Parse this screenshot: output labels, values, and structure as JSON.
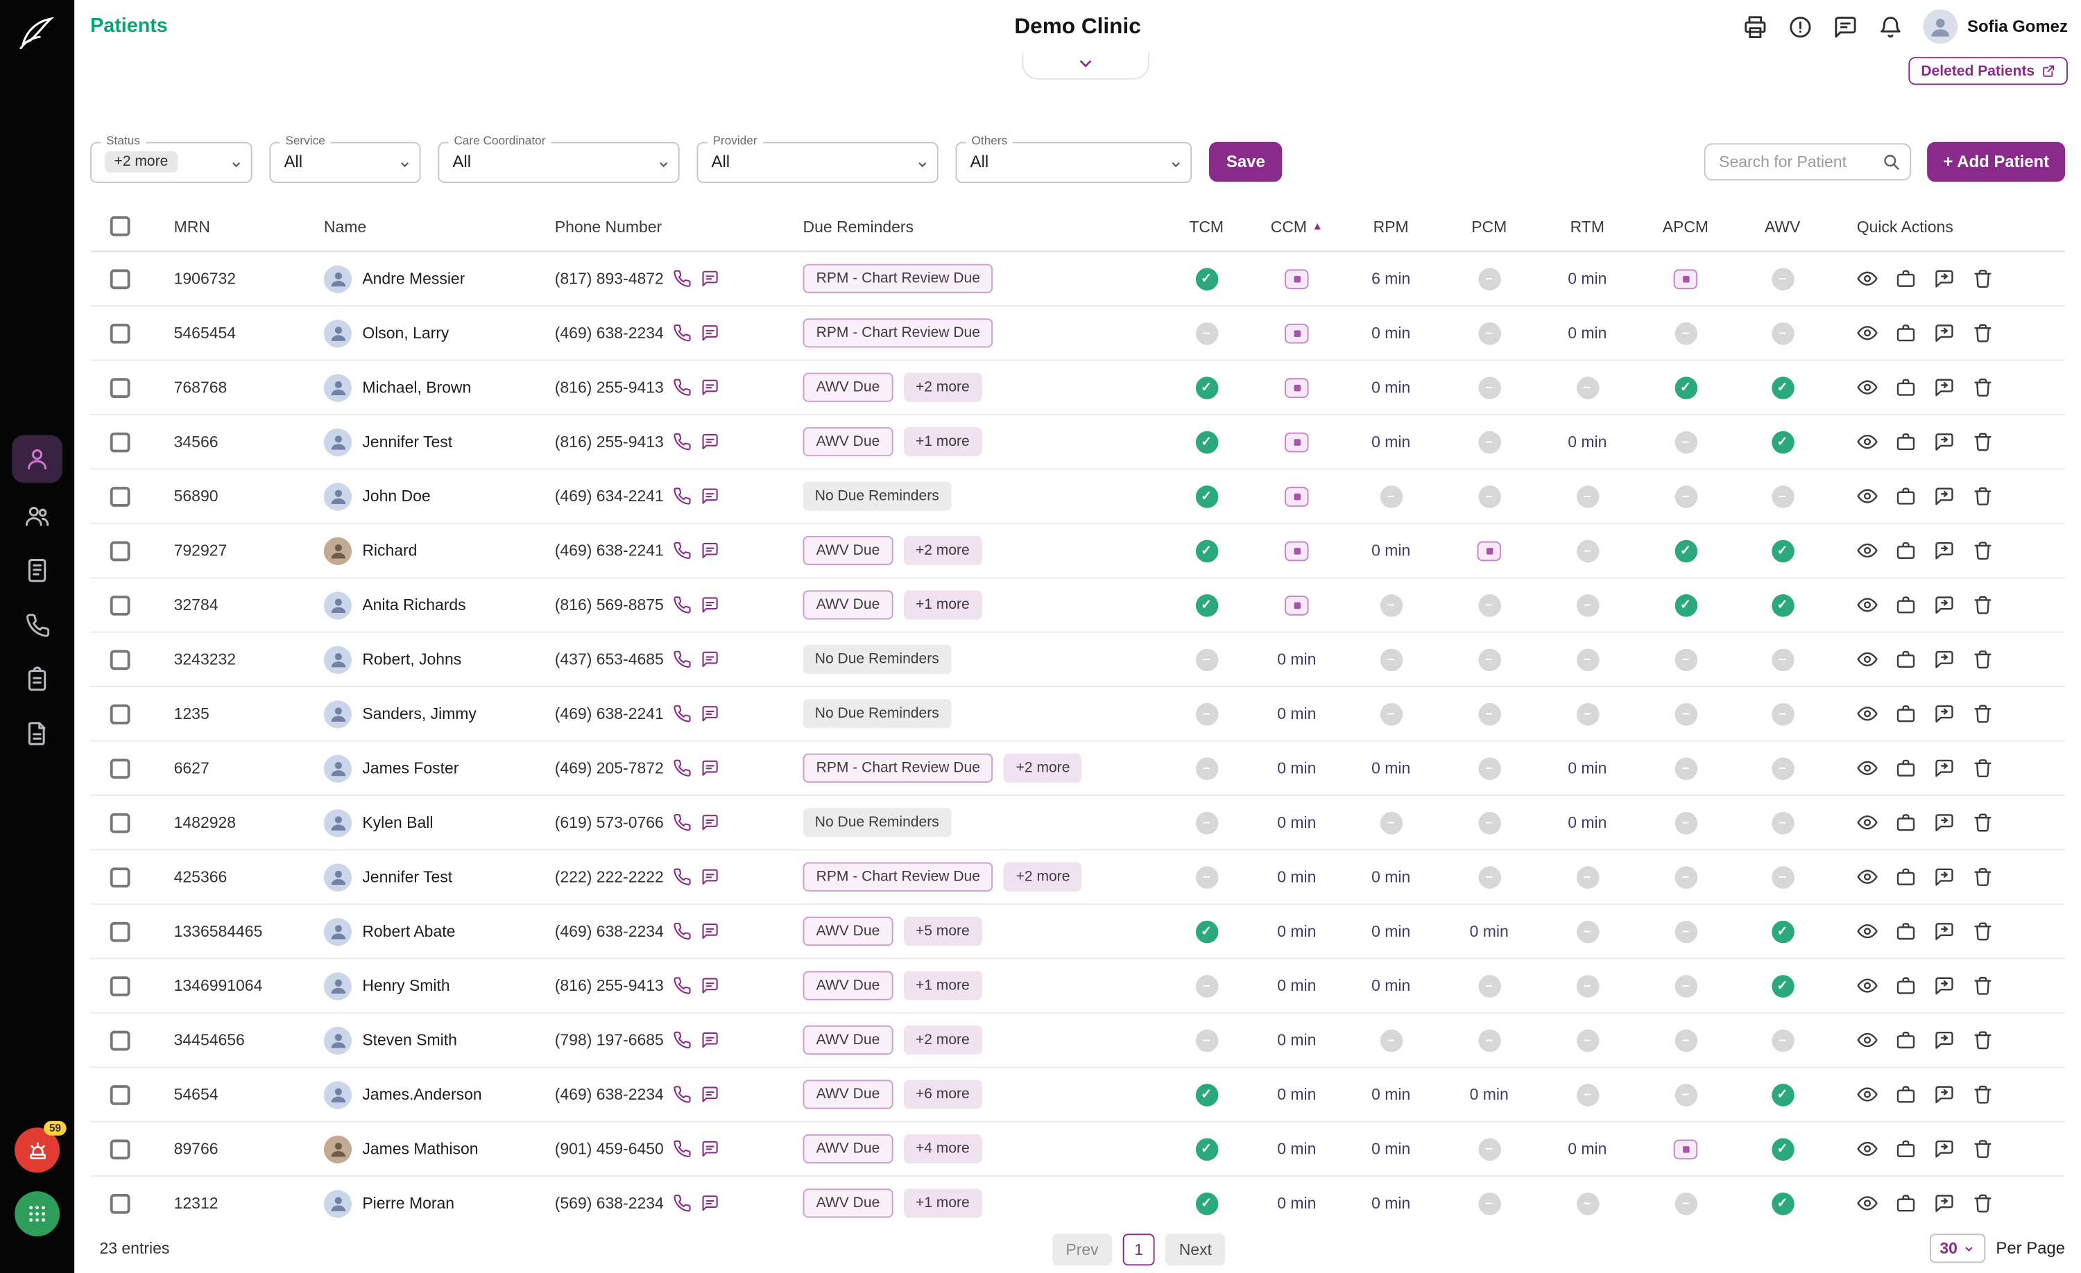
{
  "colors": {
    "accent": "#8a2a8a",
    "green": "#00a676",
    "success": "#2aa87e",
    "danger": "#e03c31"
  },
  "header": {
    "page_title": "Patients",
    "clinic_name": "Demo Clinic",
    "user_name": "Sofia Gomez",
    "deleted_patients_label": "Deleted Patients",
    "icons": [
      "fax",
      "alerts",
      "messages",
      "notifications"
    ]
  },
  "sidebar": {
    "alert_count": "59",
    "items": [
      {
        "id": "patients",
        "active": true
      },
      {
        "id": "care-team",
        "active": false
      },
      {
        "id": "devices",
        "active": false
      },
      {
        "id": "calls",
        "active": false
      },
      {
        "id": "care-plans",
        "active": false
      },
      {
        "id": "reports",
        "active": false
      }
    ]
  },
  "filters": {
    "status": {
      "label": "Status",
      "value": "+2 more"
    },
    "service": {
      "label": "Service",
      "value": "All"
    },
    "care_coordinator": {
      "label": "Care Coordinator",
      "value": "All"
    },
    "provider": {
      "label": "Provider",
      "value": "All"
    },
    "others": {
      "label": "Others",
      "value": "All"
    },
    "save_label": "Save",
    "search_placeholder": "Search for Patient",
    "add_patient_label": "+ Add Patient"
  },
  "table": {
    "columns": [
      "MRN",
      "Name",
      "Phone Number",
      "Due Reminders",
      "TCM",
      "CCM",
      "RPM",
      "PCM",
      "RTM",
      "APCM",
      "AWV",
      "Quick Actions"
    ],
    "sort_column": "CCM",
    "sort_direction": "asc",
    "quick_actions": [
      "view",
      "visits",
      "messages",
      "delete"
    ],
    "rows": [
      {
        "mrn": "1906732",
        "name": "Andre Messier",
        "avatar": "default",
        "phone": "(817) 893-4872",
        "reminders": [
          {
            "text": "RPM - Chart Review Due",
            "type": "due"
          }
        ],
        "tcm": "check",
        "ccm": "badge",
        "rpm": "6 min",
        "pcm": "dash",
        "rtm": "0 min",
        "apcm": "badge",
        "awv": "dash"
      },
      {
        "mrn": "5465454",
        "name": "Olson, Larry",
        "avatar": "default",
        "phone": "(469) 638-2234",
        "reminders": [
          {
            "text": "RPM - Chart Review Due",
            "type": "due"
          }
        ],
        "tcm": "dash",
        "ccm": "badge",
        "rpm": "0 min",
        "pcm": "dash",
        "rtm": "0 min",
        "apcm": "dash",
        "awv": "dash"
      },
      {
        "mrn": "768768",
        "name": "Michael, Brown",
        "avatar": "default",
        "phone": "(816) 255-9413",
        "reminders": [
          {
            "text": "AWV Due",
            "type": "due"
          },
          {
            "text": "+2 more",
            "type": "more"
          }
        ],
        "tcm": "check",
        "ccm": "badge",
        "rpm": "0 min",
        "pcm": "dash",
        "rtm": "dash",
        "apcm": "check",
        "awv": "check"
      },
      {
        "mrn": "34566",
        "name": "Jennifer Test",
        "avatar": "default",
        "phone": "(816) 255-9413",
        "reminders": [
          {
            "text": "AWV Due",
            "type": "due"
          },
          {
            "text": "+1 more",
            "type": "more"
          }
        ],
        "tcm": "check",
        "ccm": "badge",
        "rpm": "0 min",
        "pcm": "dash",
        "rtm": "0 min",
        "apcm": "dash",
        "awv": "check"
      },
      {
        "mrn": "56890",
        "name": "John Doe",
        "avatar": "default",
        "phone": "(469) 634-2241",
        "reminders": [
          {
            "text": "No Due Reminders",
            "type": "none"
          }
        ],
        "tcm": "check",
        "ccm": "badge",
        "rpm": "dash",
        "pcm": "dash",
        "rtm": "dash",
        "apcm": "dash",
        "awv": "dash"
      },
      {
        "mrn": "792927",
        "name": "Richard",
        "avatar": "photo",
        "phone": "(469) 638-2241",
        "reminders": [
          {
            "text": "AWV Due",
            "type": "due"
          },
          {
            "text": "+2 more",
            "type": "more"
          }
        ],
        "tcm": "check",
        "ccm": "badge",
        "rpm": "0 min",
        "pcm": "badge",
        "rtm": "dash",
        "apcm": "check",
        "awv": "check"
      },
      {
        "mrn": "32784",
        "name": "Anita Richards",
        "avatar": "default",
        "phone": "(816) 569-8875",
        "reminders": [
          {
            "text": "AWV Due",
            "type": "due"
          },
          {
            "text": "+1 more",
            "type": "more"
          }
        ],
        "tcm": "check",
        "ccm": "badge",
        "rpm": "dash",
        "pcm": "dash",
        "rtm": "dash",
        "apcm": "check",
        "awv": "check"
      },
      {
        "mrn": "3243232",
        "name": "Robert, Johns",
        "avatar": "default",
        "phone": "(437) 653-4685",
        "reminders": [
          {
            "text": "No Due Reminders",
            "type": "none"
          }
        ],
        "tcm": "dash",
        "ccm": "0 min",
        "rpm": "dash",
        "pcm": "dash",
        "rtm": "dash",
        "apcm": "dash",
        "awv": "dash"
      },
      {
        "mrn": "1235",
        "name": "Sanders, Jimmy",
        "avatar": "default",
        "phone": "(469) 638-2241",
        "reminders": [
          {
            "text": "No Due Reminders",
            "type": "none"
          }
        ],
        "tcm": "dash",
        "ccm": "0 min",
        "rpm": "dash",
        "pcm": "dash",
        "rtm": "dash",
        "apcm": "dash",
        "awv": "dash"
      },
      {
        "mrn": "6627",
        "name": "James Foster",
        "avatar": "default",
        "phone": "(469) 205-7872",
        "reminders": [
          {
            "text": "RPM - Chart Review Due",
            "type": "due"
          },
          {
            "text": "+2 more",
            "type": "more"
          }
        ],
        "tcm": "dash",
        "ccm": "0 min",
        "rpm": "0 min",
        "pcm": "dash",
        "rtm": "0 min",
        "apcm": "dash",
        "awv": "dash"
      },
      {
        "mrn": "1482928",
        "name": "Kylen Ball",
        "avatar": "default",
        "phone": "(619) 573-0766",
        "reminders": [
          {
            "text": "No Due Reminders",
            "type": "none"
          }
        ],
        "tcm": "dash",
        "ccm": "0 min",
        "rpm": "dash",
        "pcm": "dash",
        "rtm": "0 min",
        "apcm": "dash",
        "awv": "dash"
      },
      {
        "mrn": "425366",
        "name": "Jennifer Test",
        "avatar": "default",
        "phone": "(222) 222-2222",
        "reminders": [
          {
            "text": "RPM - Chart Review Due",
            "type": "due"
          },
          {
            "text": "+2 more",
            "type": "more"
          }
        ],
        "tcm": "dash",
        "ccm": "0 min",
        "rpm": "0 min",
        "pcm": "dash",
        "rtm": "dash",
        "apcm": "dash",
        "awv": "dash"
      },
      {
        "mrn": "1336584465",
        "name": "Robert Abate",
        "avatar": "default",
        "phone": "(469) 638-2234",
        "reminders": [
          {
            "text": "AWV Due",
            "type": "due"
          },
          {
            "text": "+5 more",
            "type": "more"
          }
        ],
        "tcm": "check",
        "ccm": "0 min",
        "rpm": "0 min",
        "pcm": "0 min",
        "rtm": "dash",
        "apcm": "dash",
        "awv": "check"
      },
      {
        "mrn": "1346991064",
        "name": "Henry Smith",
        "avatar": "default",
        "phone": "(816) 255-9413",
        "reminders": [
          {
            "text": "AWV Due",
            "type": "due"
          },
          {
            "text": "+1 more",
            "type": "more"
          }
        ],
        "tcm": "dash",
        "ccm": "0 min",
        "rpm": "0 min",
        "pcm": "dash",
        "rtm": "dash",
        "apcm": "dash",
        "awv": "check"
      },
      {
        "mrn": "34454656",
        "name": "Steven Smith",
        "avatar": "default",
        "phone": "(798) 197-6685",
        "reminders": [
          {
            "text": "AWV Due",
            "type": "due"
          },
          {
            "text": "+2 more",
            "type": "more"
          }
        ],
        "tcm": "dash",
        "ccm": "0 min",
        "rpm": "dash",
        "pcm": "dash",
        "rtm": "dash",
        "apcm": "dash",
        "awv": "dash"
      },
      {
        "mrn": "54654",
        "name": "James.Anderson",
        "avatar": "default",
        "phone": "(469) 638-2234",
        "reminders": [
          {
            "text": "AWV Due",
            "type": "due"
          },
          {
            "text": "+6 more",
            "type": "more"
          }
        ],
        "tcm": "check",
        "ccm": "0 min",
        "rpm": "0 min",
        "pcm": "0 min",
        "rtm": "dash",
        "apcm": "dash",
        "awv": "check"
      },
      {
        "mrn": "89766",
        "name": "James Mathison",
        "avatar": "photo",
        "phone": "(901) 459-6450",
        "reminders": [
          {
            "text": "AWV Due",
            "type": "due"
          },
          {
            "text": "+4 more",
            "type": "more"
          }
        ],
        "tcm": "check",
        "ccm": "0 min",
        "rpm": "0 min",
        "pcm": "dash",
        "rtm": "0 min",
        "apcm": "badge",
        "awv": "check"
      },
      {
        "mrn": "12312",
        "name": "Pierre Moran",
        "avatar": "default",
        "phone": "(569) 638-2234",
        "reminders": [
          {
            "text": "AWV Due",
            "type": "due"
          },
          {
            "text": "+1 more",
            "type": "more"
          }
        ],
        "tcm": "check",
        "ccm": "0 min",
        "rpm": "0 min",
        "pcm": "dash",
        "rtm": "dash",
        "apcm": "dash",
        "awv": "check"
      }
    ]
  },
  "footer": {
    "entries_text": "23 entries",
    "prev_label": "Prev",
    "page": "1",
    "next_label": "Next",
    "per_page_value": "30",
    "per_page_label": "Per Page"
  }
}
